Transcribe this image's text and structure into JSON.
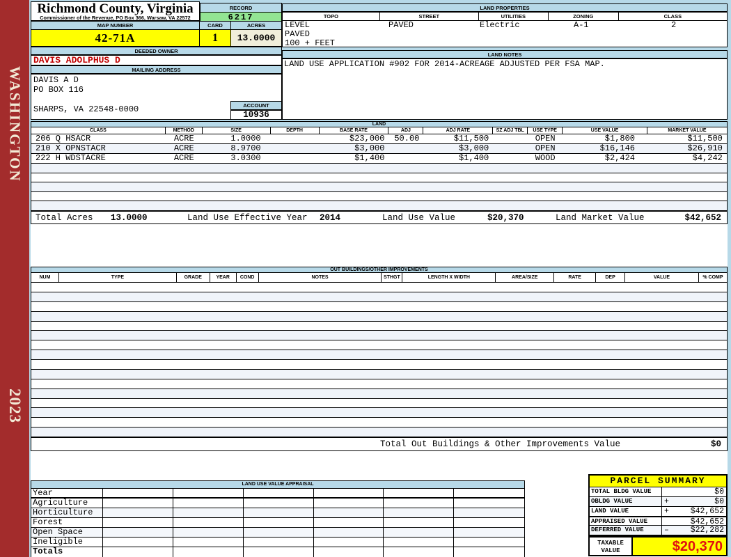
{
  "sidebar": {
    "county": "WASHINGTON",
    "year": "2023"
  },
  "header": {
    "county_title": "Richmond County, Virginia",
    "commissioner_line": "Commissioner of the Revenue, PO Box 366, Warsaw, VA 22572",
    "record_label": "RECORD",
    "record_value": "6217",
    "map_number_label": "MAP NUMBER",
    "map_number": "42-71A",
    "card_label": "CARD",
    "card": "1",
    "acres_label": "ACRES",
    "acres": "13.0000",
    "deeded_owner_label": "DEEDED OWNER",
    "deeded_owner": "DAVIS ADOLPHUS D",
    "mailing_address_label": "MAILING ADDRESS",
    "mailing_lines": [
      "DAVIS A D",
      "PO BOX 116",
      "",
      "SHARPS, VA 22548-0000"
    ],
    "account_label": "ACCOUNT",
    "account": "10936"
  },
  "land_properties": {
    "title": "LAND PROPERTIES",
    "columns": [
      "TOPO",
      "STREET",
      "UTILITIES",
      "ZONING",
      "CLASS"
    ],
    "topo_lines": [
      "LEVEL",
      "PAVED",
      "100 + FEET"
    ],
    "street": "PAVED",
    "utilities": "Electric",
    "zoning": "A-1",
    "class": "2"
  },
  "land_notes": {
    "title": "LAND NOTES",
    "text": "LAND USE APPLICATION #902 FOR 2014-ACREAGE ADJUSTED PER FSA MAP."
  },
  "land": {
    "title": "LAND",
    "columns": [
      "CLASS",
      "METHOD",
      "SIZE",
      "DEPTH",
      "BASE RATE",
      "ADJ",
      "ADJ RATE",
      "SZ ADJ TBL",
      "USE TYPE",
      "USE VALUE",
      "MARKET VALUE"
    ],
    "rows": [
      {
        "class": "206 Q HSACR",
        "method": "ACRE",
        "size": "1.0000",
        "depth": "",
        "base_rate": "$23,000",
        "adj": "50.00",
        "adj_rate": "$11,500",
        "sz_adj_tbl": "",
        "use_type": "OPEN",
        "use_value": "$1,800",
        "market_value": "$11,500"
      },
      {
        "class": "210 X OPNSTACR",
        "method": "ACRE",
        "size": "8.9700",
        "depth": "",
        "base_rate": "$3,000",
        "adj": "",
        "adj_rate": "$3,000",
        "sz_adj_tbl": "",
        "use_type": "OPEN",
        "use_value": "$16,146",
        "market_value": "$26,910"
      },
      {
        "class": "222 H WDSTACRE",
        "method": "ACRE",
        "size": "3.0300",
        "depth": "",
        "base_rate": "$1,400",
        "adj": "",
        "adj_rate": "$1,400",
        "sz_adj_tbl": "",
        "use_type": "WOOD",
        "use_value": "$2,424",
        "market_value": "$4,242"
      }
    ],
    "totals": {
      "total_acres_label": "Total Acres",
      "total_acres": "13.0000",
      "effective_year_label": "Land Use Effective Year",
      "effective_year": "2014",
      "use_value_label": "Land Use Value",
      "use_value": "$20,370",
      "market_value_label": "Land Market Value",
      "market_value": "$42,652"
    }
  },
  "out_buildings": {
    "title": "OUT BUILDINGS/OTHER IMPROVEMENTS",
    "columns": [
      "NUM",
      "TYPE",
      "GRADE",
      "YEAR",
      "COND",
      "NOTES",
      "STHGT",
      "LENGTH X WIDTH",
      "AREA/SIZE",
      "RATE",
      "DEP",
      "VALUE",
      "% COMP"
    ],
    "total_label": "Total Out Buildings & Other Improvements Value",
    "total_value": "$0"
  },
  "land_use_appraisal": {
    "title": "LAND USE VALUE APPRAISAL",
    "row_labels": [
      "Year",
      "Agriculture",
      "Horticulture",
      "Forest",
      "Open Space",
      "Ineligible",
      "Totals"
    ]
  },
  "parcel_summary": {
    "title": "PARCEL SUMMARY",
    "rows": [
      {
        "label": "TOTAL BLDG VALUE",
        "sign": "",
        "value": "$0"
      },
      {
        "label": "OBLDG VALUE",
        "sign": "+",
        "value": "$0"
      },
      {
        "label": "LAND VALUE",
        "sign": "+",
        "value": "$42,652"
      },
      {
        "label": "APPRAISED VALUE",
        "sign": "",
        "value": "$42,652"
      },
      {
        "label": "DEFERRED VALUE",
        "sign": "–",
        "value": "$22,282"
      }
    ],
    "taxable_label": "TAXABLE VALUE",
    "taxable_value": "$20,370"
  },
  "colors": {
    "sidebar_red": "#A32C2C",
    "header_blue": "#B7D9E8",
    "highlight_yellow": "#FFFF00",
    "record_green": "#93E593",
    "acres_cream": "#F0EEDA",
    "owner_red": "#C00000",
    "taxable_red": "#E01010",
    "stripe_blue": "#F0F4FA"
  }
}
